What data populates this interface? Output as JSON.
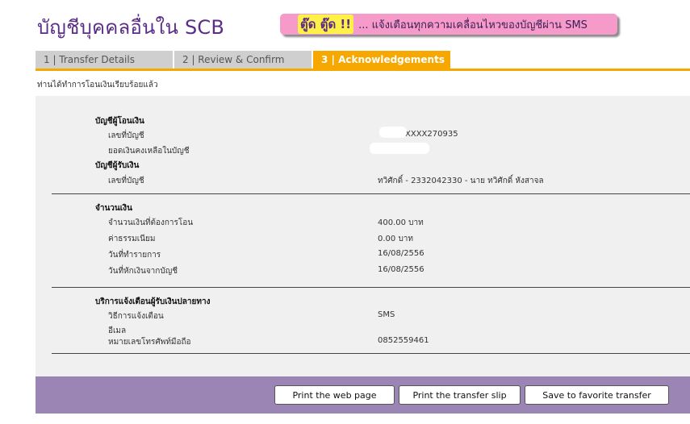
{
  "header": {
    "title": "บัญชีบุคคลอื่นใน SCB",
    "banner_highlight": "ตู๊ด ตู๊ด !!",
    "banner_text": "... แจ้งเตือนทุกความเคลื่อนไหวของบัญชีผ่าน SMS"
  },
  "tabs": [
    {
      "label": "1 | Transfer Details",
      "active": false
    },
    {
      "label": "2 | Review & Confirm",
      "active": false
    },
    {
      "label": "3 | Acknowledgements",
      "active": true
    }
  ],
  "status_message": "ท่านได้ทำการโอนเงินเรียบร้อยแล้ว",
  "from_account": {
    "heading": "บัญชีผู้โอนเงิน",
    "account_no_label": "เลขที่บัญชี",
    "account_no_value": "XXXX270935",
    "balance_label": "ยอดเงินคงเหลือในบัญชี"
  },
  "to_account": {
    "heading": "บัญชีผู้รับเงิน",
    "account_no_label": "เลขที่บัญชี",
    "account_no_value": "ทวิศักดิ์ - 2332042330 - นาย ทวิศักดิ์ หังสาจล"
  },
  "amount": {
    "heading": "จำนวนเงิน",
    "transfer_label": "จำนวนเงินที่ต้องการโอน",
    "transfer_value": "400.00 บาท",
    "fee_label": "ค่าธรรมเนียม",
    "fee_value": "0.00  บาท",
    "txn_date_label": "วันที่ทำรายการ",
    "txn_date_value": "16/08/2556",
    "debit_date_label": "วันที่หักเงินจากบัญชี",
    "debit_date_value": "16/08/2556"
  },
  "notification": {
    "heading": "บริการแจ้งเตือนผู้รับเงินปลายทาง",
    "method_label": "วิธีการแจ้งเตือน",
    "method_value": "SMS",
    "email_label": "อีเมล",
    "phone_label": "หมายเลขโทรศัพท์มือถือ",
    "phone_value": "0852559461"
  },
  "buttons": {
    "print_page": "Print the web page",
    "print_slip": "Print the transfer slip",
    "save_favorite": "Save to favorite transfer"
  },
  "colors": {
    "brand_purple": "#5b2d86",
    "tab_active": "#f6a800",
    "banner_pink": "#f59ac9",
    "footer_purple": "#9b85b4"
  }
}
